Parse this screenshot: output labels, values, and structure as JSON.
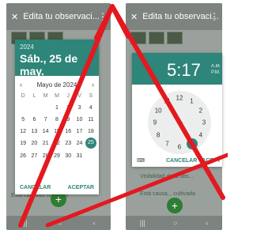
{
  "left": {
    "title": "Edita tu observaci...",
    "date_picker": {
      "year": "2024",
      "header_date": "Sáb., 25 de may.",
      "month_label": "Mayo de 2024",
      "weekday_labels": [
        "D",
        "L",
        "M",
        "M",
        "J",
        "V",
        "S"
      ],
      "days": [
        "",
        "",
        "",
        "1",
        "2",
        "3",
        "4",
        "5",
        "6",
        "7",
        "8",
        "9",
        "10",
        "11",
        "12",
        "13",
        "14",
        "15",
        "16",
        "17",
        "18",
        "19",
        "20",
        "21",
        "22",
        "23",
        "24",
        "25",
        "26",
        "27",
        "28",
        "29",
        "30",
        "31",
        ""
      ],
      "selected_day": "25",
      "cancel_label": "CANCELAR",
      "accept_label": "ACEPTAR"
    },
    "bg_label": "Está causado cultivada"
  },
  "right": {
    "title": "Edita tu observaci...",
    "time_picker": {
      "time": "5:17",
      "am": "A.M.",
      "pm": "P.M.",
      "clock_numbers": [
        "12",
        "1",
        "2",
        "3",
        "4",
        "5",
        "6",
        "7",
        "8",
        "9",
        "10",
        "11"
      ],
      "selected_number": "5",
      "cancel_label": "CANCELAR",
      "accept_label": "ACEPT"
    },
    "bg_label": "Visibilidad de la obs...",
    "bg_label_2": "Está causa... cultivada"
  },
  "colors": {
    "accent": "#2e8579",
    "overlay_red": "#e3191f"
  }
}
